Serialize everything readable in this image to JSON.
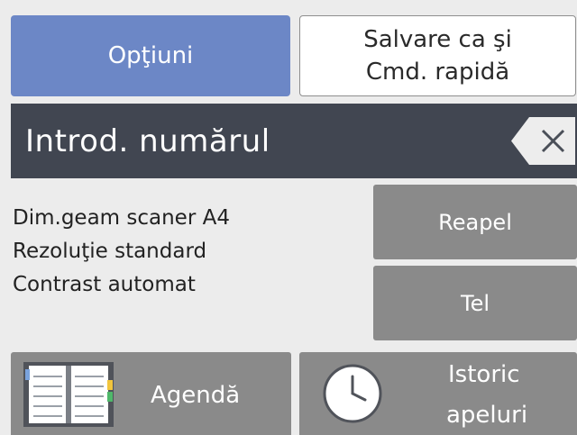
{
  "top_buttons": {
    "options_label": "Opţiuni",
    "save_line1": "Salvare ca şi",
    "save_line2": "Cmd. rapidă"
  },
  "entry": {
    "prompt": "Introd. numărul",
    "delete_icon": "backspace-icon"
  },
  "settings": [
    "Dim.geam scaner A4",
    "Rezoluţie standard",
    "Contrast automat"
  ],
  "side_buttons": {
    "redial": "Reapel",
    "tel": "Tel"
  },
  "bottom_buttons": {
    "address_book": "Agendă",
    "address_book_icon": "address-book-icon",
    "call_history_line1": "Istoric",
    "call_history_line2": "apeluri",
    "call_history_icon": "clock-icon"
  },
  "colors": {
    "accent": "#6c87c6",
    "entry_bar": "#414651",
    "button_gray": "#8a8a8a",
    "background": "#ececec"
  }
}
